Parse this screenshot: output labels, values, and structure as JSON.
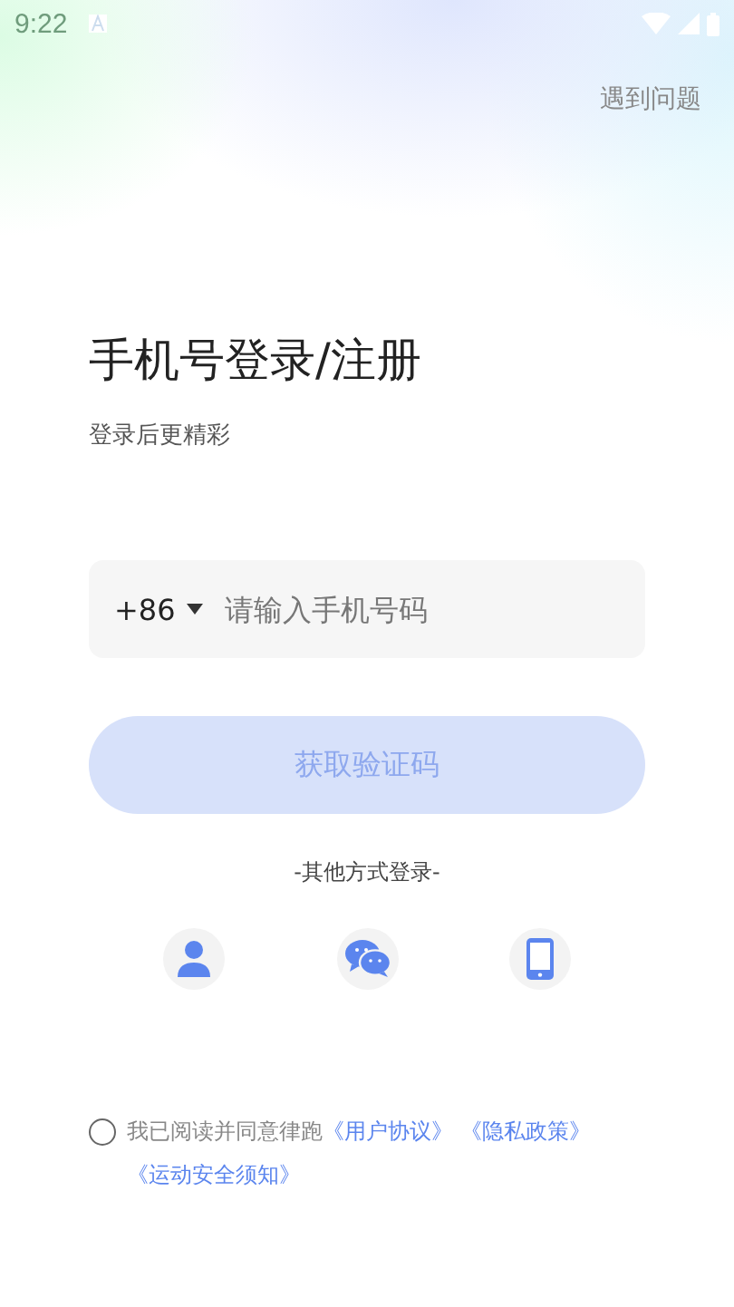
{
  "status_bar": {
    "time": "9:22"
  },
  "help_link": "遇到问题",
  "title": "手机号登录/注册",
  "subtitle": "登录后更精彩",
  "phone_field": {
    "country_code": "+86",
    "placeholder": "请输入手机号码"
  },
  "submit_button": {
    "label": "获取验证码",
    "disabled": true
  },
  "other_methods_label": "-其他方式登录-",
  "login_methods": [
    {
      "kind": "account"
    },
    {
      "kind": "wechat"
    },
    {
      "kind": "phone"
    }
  ],
  "agreement": {
    "checked": false,
    "text": "我已阅读并同意律跑",
    "links": [
      "《用户协议》",
      "《隐私政策》",
      "《运动安全须知》"
    ]
  }
}
